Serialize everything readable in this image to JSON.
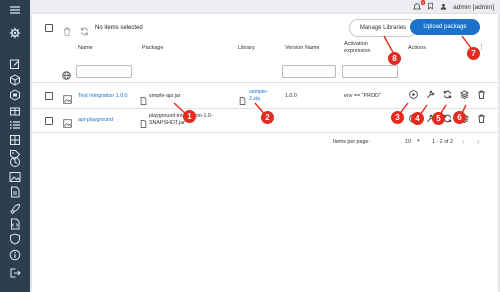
{
  "header": {
    "user": "admin [admin]",
    "notification_count": "0"
  },
  "toolbar": {
    "selection_status": "No items selected",
    "manage_libraries_label": "Manage Libraries",
    "upload_package_label": "Upload package"
  },
  "table": {
    "columns": {
      "name": "Name",
      "package": "Package",
      "library": "Library",
      "version_name": "Version Name",
      "activation_line1": "Activation",
      "activation_line2": "expression",
      "actions": "Actions"
    },
    "rows": [
      {
        "name": "Test Integration 1.0.0",
        "package": "simple-api.jar",
        "library_line1": "sample-",
        "library_line2": "2.zip",
        "version": "1.0.0",
        "activation": "env == \"PROD\""
      },
      {
        "name": "api-playground",
        "package_line1": "playground-integration-1.0-",
        "package_line2": "SNAPSHOT.jar",
        "library": "",
        "version": "",
        "activation": ""
      }
    ]
  },
  "pagination": {
    "items_per_page_label": "Items per page:",
    "items_per_page_value": "10",
    "range": "1 - 2 of 2"
  },
  "callouts": [
    "1",
    "2",
    "3",
    "4",
    "5",
    "6",
    "7",
    "8"
  ],
  "colors": {
    "sidebar": "#2d3e4f",
    "primary": "#1a73c8",
    "callout": "#e52b1e",
    "link": "#1a73c8"
  },
  "icons": {
    "sidebar": [
      "menu-icon",
      "settings-icon",
      "edit-icon",
      "cube-icon",
      "box-icon",
      "list-icon",
      "clock-icon",
      "image-icon",
      "document-icon",
      "rocket-icon",
      "script-icon",
      "shield-icon",
      "info-icon",
      "logout-icon"
    ],
    "actions": [
      "play-icon",
      "wrench-icon",
      "refresh-icon",
      "layers-icon",
      "trash-icon"
    ]
  }
}
